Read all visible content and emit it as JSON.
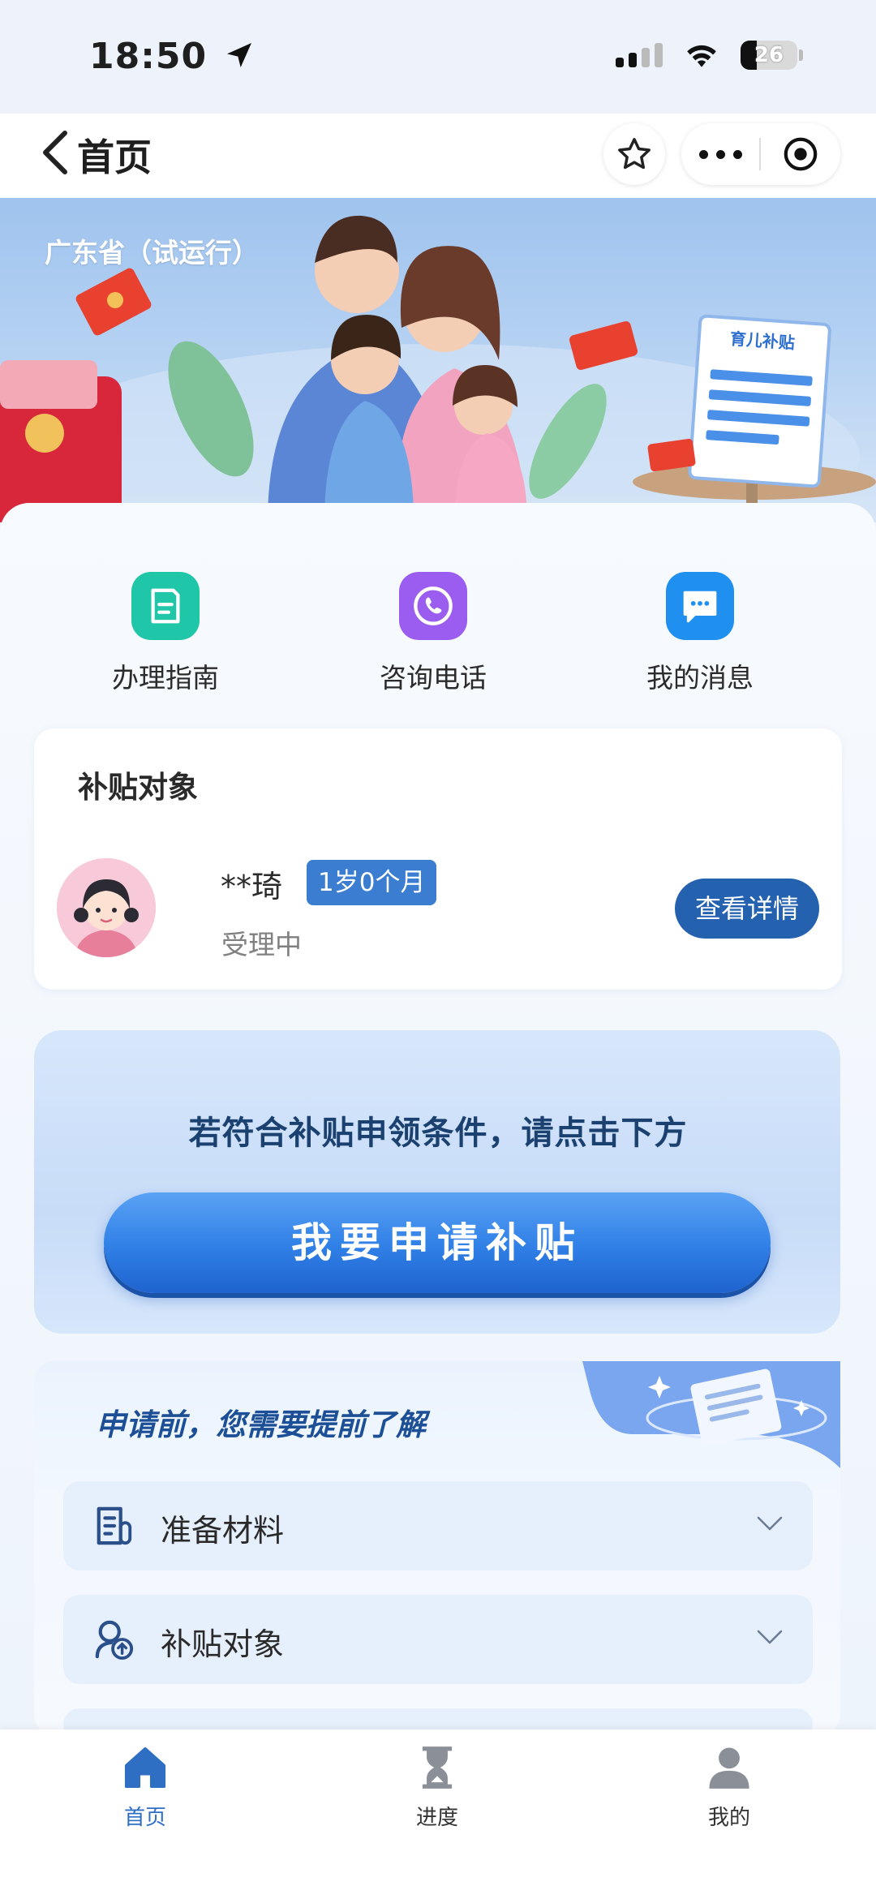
{
  "status_bar": {
    "time": "18:50",
    "battery": "26"
  },
  "nav": {
    "title": "首页"
  },
  "banner": {
    "region": "广东省（试运行）",
    "doc_label": "育儿补贴"
  },
  "quick_actions": [
    {
      "label": "办理指南",
      "icon": "document-icon",
      "color": "#1fc7a8"
    },
    {
      "label": "咨询电话",
      "icon": "phone-icon",
      "color": "#9b5cf0"
    },
    {
      "label": "我的消息",
      "icon": "message-icon",
      "color": "#1f8ff0"
    }
  ],
  "subject": {
    "title": "补贴对象",
    "name": "**琦",
    "age": "1岁0个月",
    "status": "受理中",
    "detail_button": "查看详情"
  },
  "apply": {
    "hint": "若符合补贴申领条件，请点击下方",
    "button": "我要申请补贴"
  },
  "prepare": {
    "title": "申请前，您需要提前了解",
    "items": [
      {
        "label": "准备材料",
        "icon": "materials-icon"
      },
      {
        "label": "补贴对象",
        "icon": "subject-icon"
      }
    ]
  },
  "tabbar": {
    "items": [
      {
        "label": "首页",
        "icon": "home-icon",
        "active": true
      },
      {
        "label": "进度",
        "icon": "hourglass-icon",
        "active": false
      },
      {
        "label": "我的",
        "icon": "user-icon",
        "active": false
      }
    ]
  },
  "colors": {
    "accent": "#2462b0",
    "tab_active": "#2e6fc4"
  }
}
